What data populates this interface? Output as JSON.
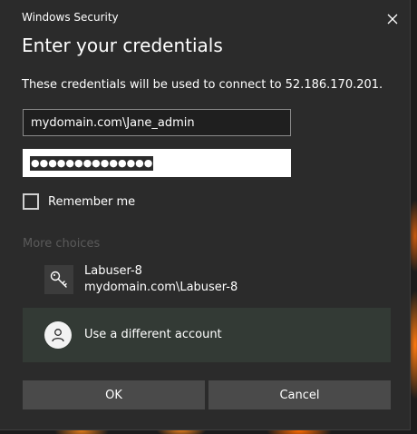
{
  "window": {
    "title": "Windows Security",
    "close_icon": "close-icon"
  },
  "dialog": {
    "heading": "Enter your credentials",
    "description": "These credentials will be used to connect to 52.186.170.201."
  },
  "form": {
    "username_value": "mydomain.com\\Jane_admin",
    "password_masked": "●●●●●●●●●●●●●●",
    "remember_label": "Remember me",
    "remember_checked": false
  },
  "more_choices": {
    "label": "More choices",
    "accounts": [
      {
        "icon": "key-icon",
        "name": "Labuser-8",
        "detail": "mydomain.com\\Labuser-8"
      },
      {
        "icon": "person-icon",
        "name": "Use a different account"
      }
    ]
  },
  "buttons": {
    "ok_label": "OK",
    "cancel_label": "Cancel"
  },
  "colors": {
    "dialog_bg": "#2b2b2b",
    "selected_item_bg": "#333a35",
    "button_bg": "#4a4a4a",
    "muted_text": "#5a5a5a"
  }
}
